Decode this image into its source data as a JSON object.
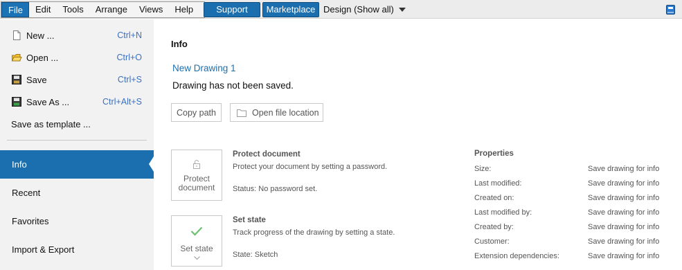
{
  "menubar": {
    "items": [
      "File",
      "Edit",
      "Tools",
      "Arrange",
      "Views",
      "Help"
    ],
    "support_label": "Support",
    "marketplace_label": "Marketplace",
    "design_label": "Design (Show all)"
  },
  "backstage": {
    "commands": [
      {
        "label": "New ...",
        "shortcut": "Ctrl+N",
        "icon": "new-document-icon"
      },
      {
        "label": "Open ...",
        "shortcut": "Ctrl+O",
        "icon": "open-folder-icon"
      },
      {
        "label": "Save",
        "shortcut": "Ctrl+S",
        "icon": "save-disk-icon"
      },
      {
        "label": "Save As ...",
        "shortcut": "Ctrl+Alt+S",
        "icon": "save-as-icon"
      },
      {
        "label": "Save as template ...",
        "shortcut": ""
      }
    ],
    "nav": [
      "Info",
      "Recent",
      "Favorites",
      "Import & Export"
    ]
  },
  "info": {
    "heading": "Info",
    "drawing_name": "New Drawing 1",
    "saved_status": "Drawing has not been saved.",
    "copy_path_label": "Copy path",
    "open_location_label": "Open file location",
    "protect": {
      "tile_label_1": "Protect",
      "tile_label_2": "document",
      "title": "Protect document",
      "description": "Protect your document by setting a password.",
      "status": "Status: No password set."
    },
    "state": {
      "tile_label": "Set state",
      "title": "Set state",
      "description": "Track progress of the drawing by setting a state.",
      "status": "State: Sketch"
    },
    "properties": {
      "title": "Properties",
      "rows": [
        {
          "key": "Size:",
          "value": "Save drawing for info"
        },
        {
          "key": "Last modified:",
          "value": "Save drawing for info"
        },
        {
          "key": "Created on:",
          "value": "Save drawing for info"
        },
        {
          "key": "Last modified by:",
          "value": "Save drawing for info"
        },
        {
          "key": "Created by:",
          "value": "Save drawing for info"
        },
        {
          "key": "Customer:",
          "value": "Save drawing for info"
        },
        {
          "key": "Extension dependencies:",
          "value": "Save drawing for info"
        }
      ]
    }
  },
  "colors": {
    "accent": "#1c6fae",
    "shortcut": "#3b6fc0",
    "checkmark": "#5cb85c"
  }
}
